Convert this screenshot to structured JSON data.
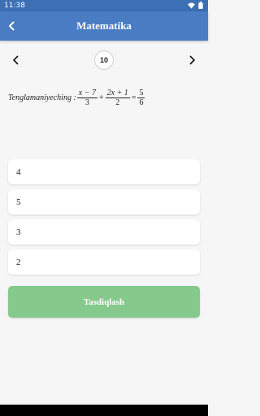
{
  "status_bar": {
    "time": "11:38"
  },
  "app_bar": {
    "title": "Matematika"
  },
  "question_nav": {
    "number": "10"
  },
  "question": {
    "prefix": "Tenglamaniyeching :",
    "fraction1": {
      "numerator": "x − 7",
      "denominator": "3"
    },
    "operator_plus": "+",
    "fraction2": {
      "numerator": "2x + 1",
      "denominator": "2"
    },
    "operator_equals": "=",
    "fraction3": {
      "numerator": "5",
      "denominator": "6"
    }
  },
  "options": [
    "4",
    "5",
    "3",
    "2"
  ],
  "submit_button": {
    "label": "Tasdiqlash"
  },
  "colors": {
    "app_bar": "#4a7cc4",
    "status_bar": "#3d6fb5",
    "submit_button": "#86c98c",
    "background": "#f6f6f6"
  },
  "icons": {
    "back": "arrow-left-icon",
    "prev": "chevron-left-icon",
    "next": "chevron-right-icon",
    "wifi": "wifi-icon",
    "battery": "battery-icon"
  }
}
